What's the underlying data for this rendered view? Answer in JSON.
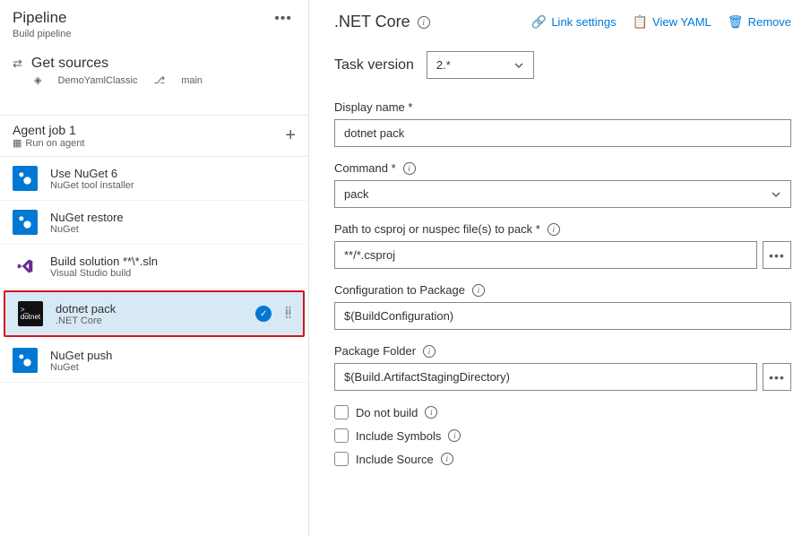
{
  "pipeline": {
    "title": "Pipeline",
    "subtitle": "Build pipeline"
  },
  "getSources": {
    "title": "Get sources",
    "repo": "DemoYamlClassic",
    "branch": "main"
  },
  "agentJob": {
    "title": "Agent job 1",
    "subtitle": "Run on agent"
  },
  "tasks": [
    {
      "title": "Use NuGet 6",
      "sub": "NuGet tool installer",
      "icon": "nuget"
    },
    {
      "title": "NuGet restore",
      "sub": "NuGet",
      "icon": "nuget"
    },
    {
      "title": "Build solution **\\*.sln",
      "sub": "Visual Studio build",
      "icon": "vs"
    },
    {
      "title": "dotnet pack",
      "sub": ".NET Core",
      "icon": "dotnet",
      "selected": true
    },
    {
      "title": "NuGet push",
      "sub": "NuGet",
      "icon": "nuget"
    }
  ],
  "detail": {
    "title": ".NET Core",
    "actions": {
      "link": "Link settings",
      "yaml": "View YAML",
      "remove": "Remove"
    },
    "taskVersionLabel": "Task version",
    "taskVersion": "2.*",
    "displayNameLabel": "Display name *",
    "displayName": "dotnet pack",
    "commandLabel": "Command *",
    "command": "pack",
    "pathLabel": "Path to csproj or nuspec file(s) to pack *",
    "path": "**/*.csproj",
    "configLabel": "Configuration to Package",
    "config": "$(BuildConfiguration)",
    "folderLabel": "Package Folder",
    "folder": "$(Build.ArtifactStagingDirectory)",
    "cbNoBuild": "Do not build",
    "cbSymbols": "Include Symbols",
    "cbSource": "Include Source"
  }
}
